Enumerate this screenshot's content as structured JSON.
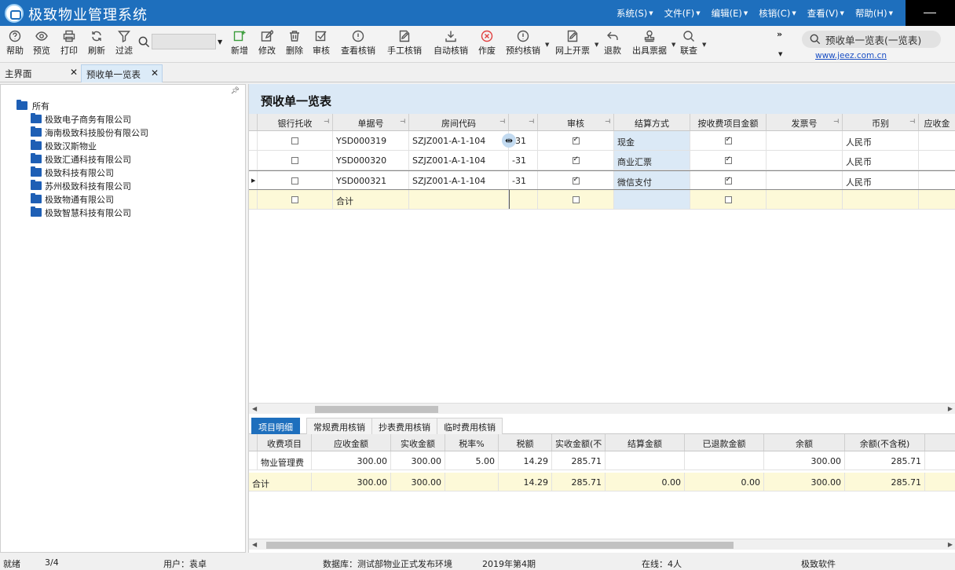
{
  "app": {
    "title": "极致物业管理系统"
  },
  "menu": [
    {
      "label": "系统(S)"
    },
    {
      "label": "文件(F)"
    },
    {
      "label": "编辑(E)"
    },
    {
      "label": "核销(C)"
    },
    {
      "label": "查看(V)"
    },
    {
      "label": "帮助(H)"
    }
  ],
  "toolbar": {
    "help": "帮助",
    "preview": "预览",
    "print": "打印",
    "refresh": "刷新",
    "filter": "过滤",
    "new": "新增",
    "edit": "修改",
    "delete": "删除",
    "audit": "审核",
    "view_writeoff": "查看核销",
    "manual_writeoff": "手工核销",
    "auto_writeoff": "自动核销",
    "void": "作废",
    "reserve_writeoff": "预约核销",
    "online_invoice": "网上开票",
    "refund": "退款",
    "issue_receipt": "出具票据",
    "query": "联查",
    "search_value": "",
    "right_search": "预收单一览表(一览表)",
    "weblink": "www.jeez.com.cn"
  },
  "doc_tabs": [
    {
      "label": "主界面"
    },
    {
      "label": "预收单一览表"
    }
  ],
  "tree": {
    "root": "所有",
    "children": [
      "极致电子商务有限公司",
      "海南极致科技股份有限公司",
      "极致汉斯物业",
      "极致汇通科技有限公司",
      "极致科技有限公司",
      "苏州极致科技有限公司",
      "极致物通有限公司",
      "极致智慧科技有限公司"
    ]
  },
  "list": {
    "title": "预收单一览表",
    "headers": {
      "bank": "银行托收",
      "doc_no": "单据号",
      "room": "房间代码",
      "date": "",
      "audit": "审核",
      "settle": "结算方式",
      "by_item": "按收费项目金额",
      "invoice": "发票号",
      "currency": "币别",
      "receivable": "应收金"
    },
    "rows": [
      {
        "doc_no": "YSD000319",
        "room": "SZJZ001-A-1-104",
        "date": "-31",
        "settle": "现金",
        "currency": "人民币"
      },
      {
        "doc_no": "YSD000320",
        "room": "SZJZ001-A-1-104",
        "date": "-31",
        "settle": "商业汇票",
        "currency": "人民币"
      },
      {
        "doc_no": "YSD000321",
        "room": "SZJZ001-A-1-104",
        "date": "-31",
        "settle": "微信支付",
        "currency": "人民币"
      }
    ],
    "sum_label": "合计"
  },
  "bottom_tabs": [
    {
      "label": "项目明细"
    },
    {
      "label": "常规费用核销"
    },
    {
      "label": "抄表费用核销"
    },
    {
      "label": "临时费用核销"
    }
  ],
  "detail": {
    "headers": [
      "收费项目",
      "应收金额",
      "实收金额",
      "税率%",
      "税额",
      "实收金额(不",
      "结算金额",
      "已退款金额",
      "余额",
      "余额(不含税)"
    ],
    "row": [
      "物业管理费",
      "300.00",
      "300.00",
      "5.00",
      "14.29",
      "285.71",
      "",
      "",
      "300.00",
      "285.71"
    ],
    "sum": [
      "合计",
      "300.00",
      "300.00",
      "",
      "14.29",
      "285.71",
      "0.00",
      "0.00",
      "300.00",
      "285.71"
    ]
  },
  "status": {
    "state": "就绪",
    "page": "3/4",
    "user": "用户：袁卓",
    "db": "数据库：测试部物业正式发布环境",
    "period": "2019年第4期",
    "online": "在线：4人",
    "vendor": "极致软件"
  }
}
